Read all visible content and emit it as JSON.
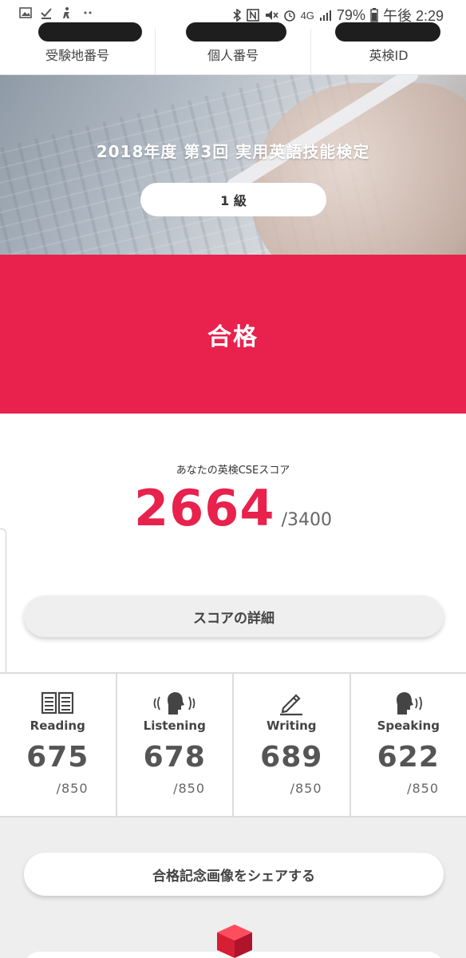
{
  "status_bar": {
    "network": "4G",
    "battery": "79%",
    "time": "午後 2:29"
  },
  "header": {
    "exam_site_label": "受験地番号",
    "personal_number_label": "個人番号",
    "eiken_id_label": "英検ID"
  },
  "hero": {
    "title": "2018年度 第3回 実用英語技能検定",
    "grade": "1 級"
  },
  "result": {
    "status": "合格"
  },
  "score": {
    "caption": "あなたの英検CSEスコア",
    "value": "2664",
    "max": "/3400"
  },
  "detail_button": "スコアの詳細",
  "skills": [
    {
      "name": "Reading",
      "score": "675",
      "max": "/850",
      "icon": "book-icon"
    },
    {
      "name": "Listening",
      "score": "678",
      "max": "/850",
      "icon": "listening-head-icon"
    },
    {
      "name": "Writing",
      "score": "689",
      "max": "/850",
      "icon": "pencil-icon"
    },
    {
      "name": "Speaking",
      "score": "622",
      "max": "/850",
      "icon": "speaking-head-icon"
    }
  ],
  "share_button": "合格記念画像をシェアする",
  "colors": {
    "accent": "#e8214d",
    "text": "#444444",
    "panel": "#eeeeee"
  }
}
